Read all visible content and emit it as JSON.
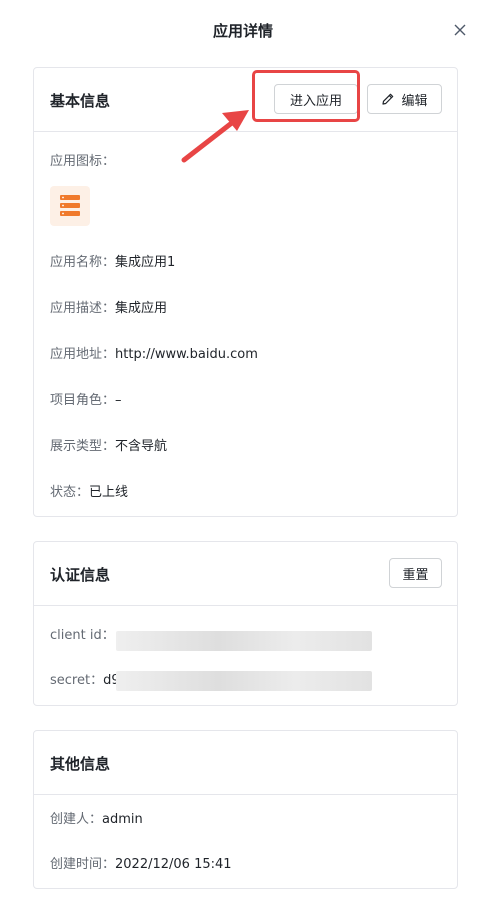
{
  "header": {
    "title": "应用详情"
  },
  "basic": {
    "title": "基本信息",
    "enter_button": "进入应用",
    "edit_button": "编辑",
    "icon_label": "应用图标：",
    "fields": [
      {
        "label": "应用名称：",
        "value": "集成应用1"
      },
      {
        "label": "应用描述：",
        "value": "集成应用"
      },
      {
        "label": "应用地址：",
        "value": "http://www.baidu.com"
      },
      {
        "label": "项目角色：",
        "value": "–"
      },
      {
        "label": "展示类型：",
        "value": "不含导航"
      },
      {
        "label": "状态：",
        "value": "已上线"
      }
    ]
  },
  "auth": {
    "title": "认证信息",
    "reset_button": "重置",
    "client_id_label": "client id：",
    "secret_label": "secret：",
    "secret_value_visible": "d9"
  },
  "other": {
    "title": "其他信息",
    "creator_label": "创建人：",
    "creator_value": "admin",
    "created_label": "创建时间：",
    "created_value": "2022/12/06 15:41"
  },
  "colors": {
    "highlight_red": "#e84545",
    "app_icon_orange": "#f07a2c",
    "border": "#e5e6eb"
  }
}
